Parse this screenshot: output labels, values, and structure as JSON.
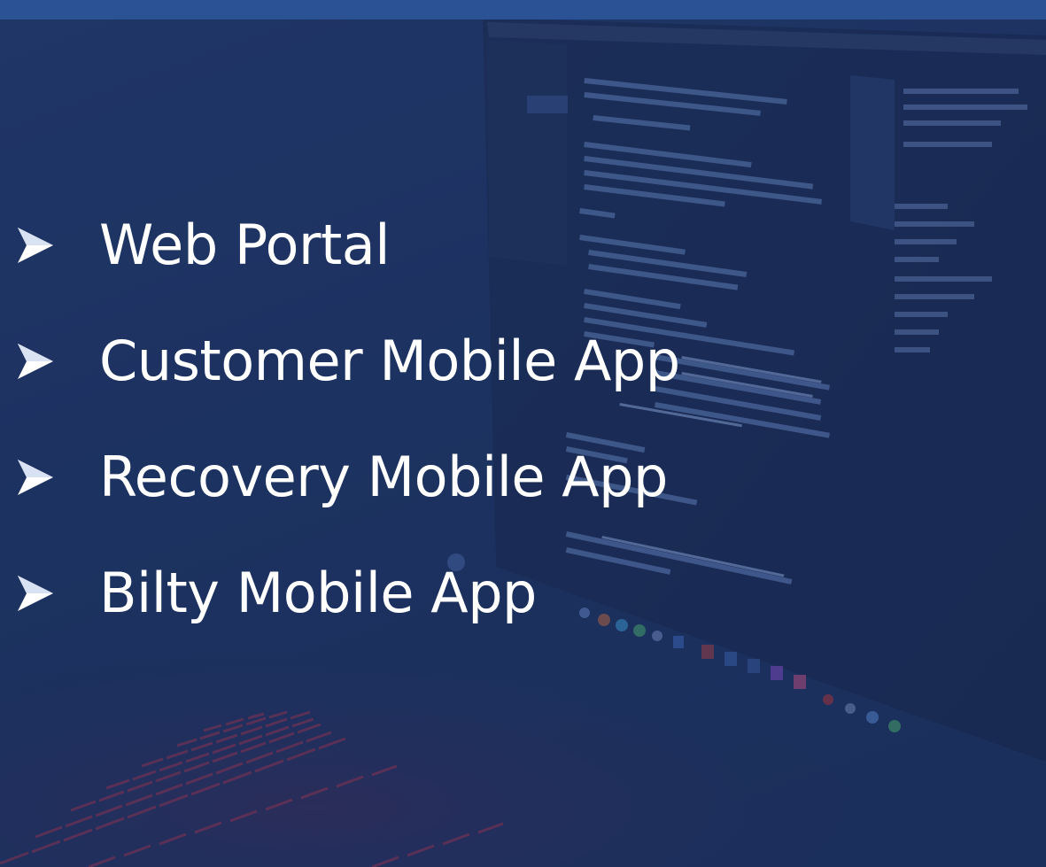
{
  "slide": {
    "bullets": [
      {
        "label": "Web Portal"
      },
      {
        "label": "Customer Mobile App"
      },
      {
        "label": "Recovery Mobile App"
      },
      {
        "label": "Bilty Mobile App"
      }
    ],
    "bullet_icon": "arrowhead-bullet-icon",
    "colors": {
      "background": "#1f3560",
      "top_strip": "#2c5296",
      "text": "#ffffff",
      "keyboard_glow": "#c2344a"
    },
    "background_image": "laptop-with-code-editor-photo"
  }
}
